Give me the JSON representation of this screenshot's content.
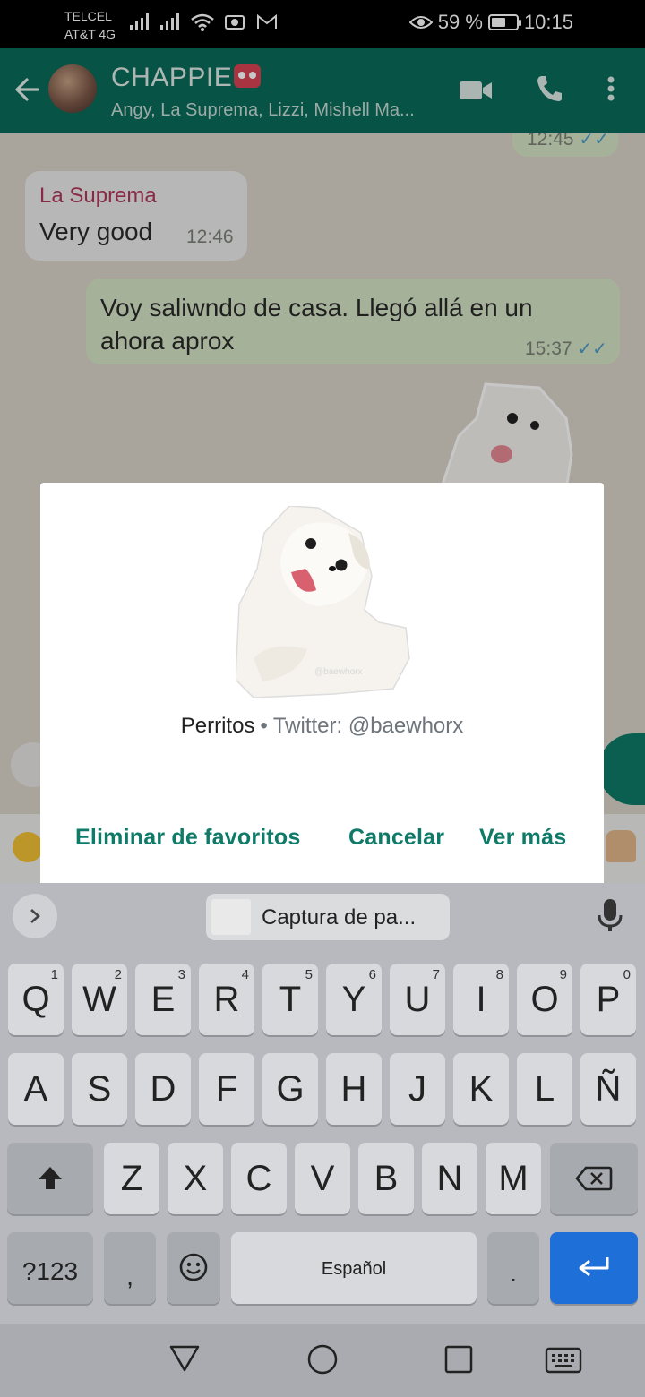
{
  "status_bar": {
    "carrier_1": "TELCEL",
    "carrier_2": "AT&T 4G",
    "battery_percent_text": "59 %",
    "battery_level": 0.59,
    "time": "10:15"
  },
  "header": {
    "title": "CHAPPIE",
    "members": "Angy, La Suprema, Lizzi, Mishell Ma..."
  },
  "messages": [
    {
      "type": "out_time_only",
      "time": "12:45"
    },
    {
      "type": "in",
      "sender": "La Suprema",
      "text": "Very good",
      "time": "12:46"
    },
    {
      "type": "out",
      "text_line1": "Voy saliwndo de casa. Llegó allá en un",
      "text_line2": "ahora aprox",
      "time": "15:37"
    }
  ],
  "dialog": {
    "sticker_watermark": "@baewhorx",
    "pack_name": "Perritos",
    "separator": "•",
    "author": "Twitter: @baewhorx",
    "buttons": {
      "remove": "Eliminar de favoritos",
      "cancel": "Cancelar",
      "more": "Ver más"
    }
  },
  "keyboard": {
    "clipboard_text": "Captura de pa...",
    "row1": [
      {
        "k": "Q",
        "n": "1"
      },
      {
        "k": "W",
        "n": "2"
      },
      {
        "k": "E",
        "n": "3"
      },
      {
        "k": "R",
        "n": "4"
      },
      {
        "k": "T",
        "n": "5"
      },
      {
        "k": "Y",
        "n": "6"
      },
      {
        "k": "U",
        "n": "7"
      },
      {
        "k": "I",
        "n": "8"
      },
      {
        "k": "O",
        "n": "9"
      },
      {
        "k": "P",
        "n": "0"
      }
    ],
    "row2": [
      "A",
      "S",
      "D",
      "F",
      "G",
      "H",
      "J",
      "K",
      "L",
      "Ñ"
    ],
    "row3": [
      "Z",
      "X",
      "C",
      "V",
      "B",
      "N",
      "M"
    ],
    "symbols_key": "?123",
    "comma_key": ",",
    "space_label": "Español",
    "period_key": "."
  }
}
